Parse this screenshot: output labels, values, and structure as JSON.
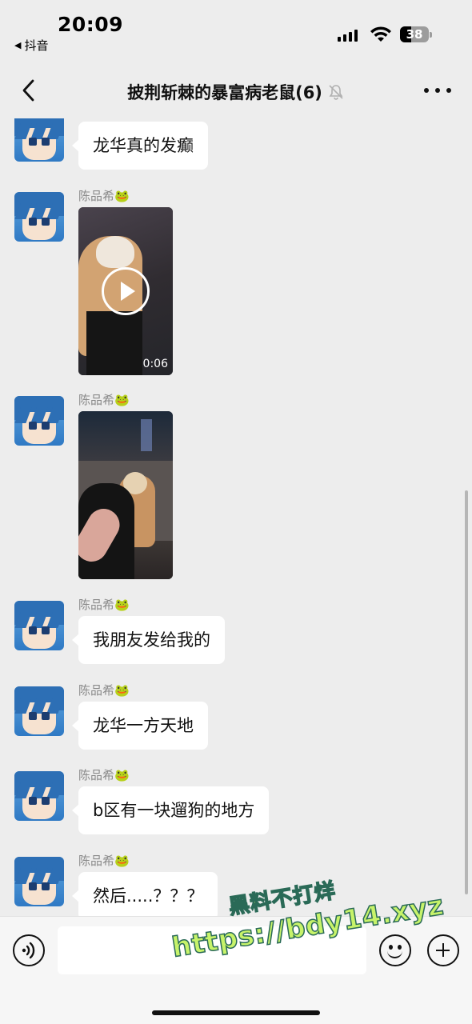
{
  "status_bar": {
    "time": "20:09",
    "back_app": "抖音",
    "battery": "38"
  },
  "nav": {
    "title": "披荆斩棘的暴富病老鼠(6)",
    "back_icon": "chevron-left-icon",
    "mute_icon": "bell-slash-icon",
    "more_icon": "ellipsis-icon"
  },
  "messages": [
    {
      "type": "text",
      "sender": "",
      "text": "龙华真的发癫"
    },
    {
      "type": "video",
      "sender": "陈品希🐸",
      "duration": "0:06"
    },
    {
      "type": "image",
      "sender": "陈品希🐸"
    },
    {
      "type": "text",
      "sender": "陈品希🐸",
      "text": "我朋友发给我的"
    },
    {
      "type": "text",
      "sender": "陈品希🐸",
      "text": "龙华一方天地"
    },
    {
      "type": "text",
      "sender": "陈品希🐸",
      "text": "b区有一块遛狗的地方"
    },
    {
      "type": "text",
      "sender": "陈品希🐸",
      "text": "然后.....？？？"
    }
  ],
  "input_bar": {
    "placeholder": "",
    "voice_icon": "voice-icon",
    "emoji_icon": "emoji-icon",
    "plus_icon": "plus-icon"
  },
  "watermark": {
    "line1": "黑料不打烊",
    "line2": "https://bdy14.xyz"
  },
  "colors": {
    "background": "#ededed",
    "bubble": "#ffffff",
    "sender_text": "#8a8a8a",
    "watermark_fill": "#c7f36a"
  }
}
